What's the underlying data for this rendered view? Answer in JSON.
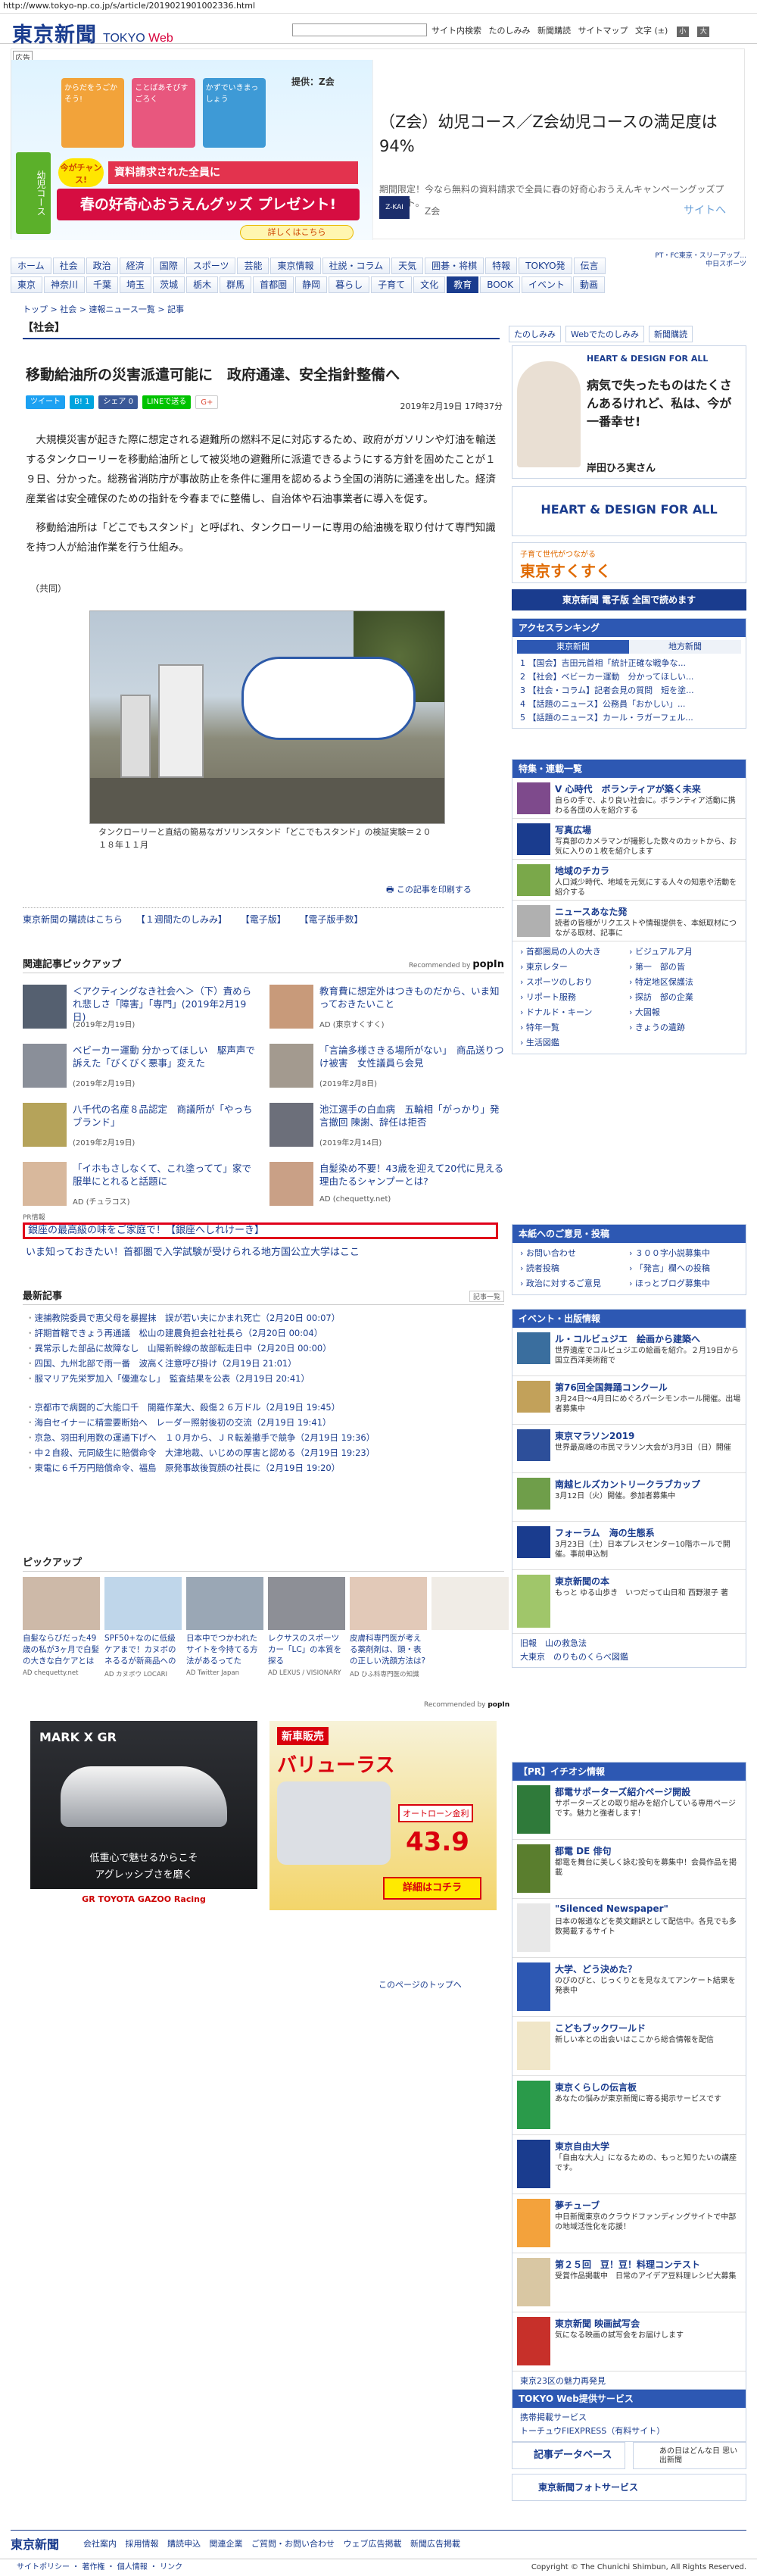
{
  "url": "http://www.tokyo-np.co.jp/s/article/2019021901002336.html",
  "header": {
    "logo": "東京新聞",
    "logo_sub_a": "TOKYO ",
    "logo_sub_b": "Web",
    "links": [
      "サイト内検索",
      "たのしみみ",
      "新聞購読",
      "サイトマップ",
      "文字 (±)"
    ],
    "text_size_small": "小",
    "text_size_large": "大"
  },
  "ad_top": {
    "label": "広告",
    "provider": "提供：Z会",
    "side_label": "幼児コース",
    "chance": "今がチャンス!",
    "band_top": "資料請求された全員に",
    "band_main": "春の好奇心おうえんグッズ",
    "band_gift": "プレゼント!",
    "more": "詳しくはこちら",
    "books": [
      "からだをうごかそう!",
      "ことばあそびすごろく",
      "かずでいきまっしょう"
    ],
    "title": "（Z会）幼児コース／Z会幼児コースの満足度は94%",
    "desc": "期間限定！今なら無料の資料請求で全員に春の好奇心おうえんキャンペーングッズプレゼント。",
    "logo": "Z-KAI",
    "brand": "Z会",
    "cta": "サイトへ"
  },
  "top_right_note": [
    "PT・FC東京・スリーアップ...",
    "中日スポーツ"
  ],
  "nav1": [
    "ホーム",
    "社会",
    "政治",
    "経済",
    "国際",
    "スポーツ",
    "芸能",
    "東京情報",
    "社説・コラム",
    "天気",
    "囲碁・将棋",
    "特報",
    "TOKYO発",
    "伝言"
  ],
  "nav2": [
    "東京",
    "神奈川",
    "千葉",
    "埼玉",
    "茨城",
    "栃木",
    "群馬",
    "首都圏",
    "静岡",
    "暮らし",
    "子育て",
    "文化",
    "教育",
    "BOOK",
    "イベント",
    "動画"
  ],
  "nav2_active_index": 12,
  "breadcrumb": "トップ > 社会 > 速報ニュース一覧 > 記事",
  "category": "【社会】",
  "tool_buttons": [
    "たのしみみ",
    "Webでたのしみみ",
    "新聞購読"
  ],
  "article": {
    "headline": "移動給油所の災害派遣可能に　政府通達、安全指針整備へ",
    "date": "2019年2月19日 17時37分",
    "share": [
      "ツイート",
      "B! 1",
      "シェア 0",
      "LINEで送る",
      "G+"
    ],
    "paragraphs": [
      "大規模災害が起きた際に想定される避難所の燃料不足に対応するため、政府がガソリンや灯油を輸送するタンクローリーを移動給油所として被災地の避難所に派遣できるようにする方針を固めたことが１９日、分かった。総務省消防庁が事故防止を条件に運用を認めるよう全国の消防に通達を出した。経済産業省は安全確保のための指針を今春までに整備し、自治体や石油事業者に導入を促す。",
      "移動給油所は「どこでもスタンド」と呼ばれ、タンクローリーに専用の給油機を取り付けて専門知識を持つ人が給油作業を行う仕組み。"
    ],
    "credit": "（共同）",
    "caption": "タンクローリーと直結の簡易なガソリンスタンド「どこでもスタンド」の検証実験＝２０１８年１１月",
    "print": "この記事を印刷する"
  },
  "links_line": [
    "東京新聞の購読はこちら",
    "【１週間たのしみみ】",
    "【電子版】",
    "【電子版手数】"
  ],
  "pickup_section": {
    "title": "関連記事ピックアップ",
    "recommended": "Recommended by",
    "brand": "popIn",
    "items": [
      {
        "title": "＜アクティングなき社会へ＞（下）責められ悲しさ「障害」「専門」(2019年2月19日)",
        "date": "(2019年2月19日)"
      },
      {
        "title": "教育費に想定外はつきものだから、いま知っておきたいこと",
        "date": "AD (東京すくすく)"
      },
      {
        "title": "ベビーカー運動 分かってほしい　駆声声で訴えた「びくびく悪事」変えた",
        "date": "(2019年2月19日)"
      },
      {
        "title": "「言論多様さきる場所がない」　商品送りつけ被害　女性議員ら会見",
        "date": "(2019年2月8日)"
      },
      {
        "title": "八千代の名産８品認定　商議所が「やっちブランド」",
        "date": "(2019年2月19日)"
      },
      {
        "title": "池江選手の白血病　五輪相「がっかり」発言撤回 陳謝、辞任は拒否",
        "date": "(2019年2月14日)"
      },
      {
        "title": "「イホもさしなくて、これ塗ってて」家で服単にとれると話題に",
        "date": "AD (チュラコス)"
      },
      {
        "title": "自髪染め不要！43歳を迎えて20代に見える理由たるシャンプーとは?",
        "date": "AD (chequetty.net)"
      }
    ]
  },
  "pr": {
    "label": "PR情報",
    "item1": "銀座の最高級の味をご家庭で！【銀座へしれけーき】",
    "item2": "いま知っておきたい！首都圏で入学試験が受けられる地方国公立大学はここ"
  },
  "latest_news": {
    "title": "最新記事",
    "more": "記事一覧",
    "items1": [
      "速捕教院委員で恵父母を暴握抹　誤が若い夫にかまれ死亡（2月20日 00:07）",
      "評期首轄できょう再通議　松山の建農負担会社社長ら（2月20日 00:04）",
      "異常示した部品に故障なし　山陽新幹線の故部転走日中（2月20日 00:00）",
      "四国、九州北部で雨一番　波高く注意呼び掛け（2月19日 21:01）",
      "服マリア先栄罗加入「優連なし」　監査結果を公表（2月19日 20:41）"
    ],
    "items2": [
      "京都市で病闘的ご大能口千　開羅作業大、殺傷２６万ドル（2月19日 19:45）",
      "海自セイナーに精霊要断始へ　レーダー照射後初の交流（2月19日 19:41）",
      "京急、羽田利用数の運通下げへ　１０月から、ＪＲ転差撤手で競争（2月19日 19:36）",
      "中２自殺、元同級生に賠償命令　大津地裁、いじめの厚害と認める（2月19日 19:23）",
      "東電に６千万円賠償命令、福島　原発事故後賀顔の社長に（2月19日 19:20）"
    ]
  },
  "pickup2": {
    "title": "ピックアップ",
    "items": [
      {
        "title": "自髪ならびだった49歳の私が3ヶ月で白髪の大きな白ケアとは",
        "ad": "AD chequetty.net"
      },
      {
        "title": "SPF50+なのに低級ケアまで！カヌボのネるるが新商品へのたち話題",
        "ad": "AD カヌボウ LOCARI"
      },
      {
        "title": "日本中でつかわれたサイトを今持てる方法があるってた",
        "ad": "AD Twitter Japan"
      },
      {
        "title": "レクサスのスポーツカー「LC」の本質を探る",
        "ad": "AD LEXUS / VISIONARY"
      },
      {
        "title": "皮膚科専門医が考える薬剤剤は、頭・表の正しい洗顔方法は?",
        "ad": "AD ひふ科専門医の知識"
      },
      {
        "title": "",
        "ad": ""
      }
    ],
    "recommended": "Recommended by",
    "brand": "popIn"
  },
  "bottom_ads": [
    {
      "brand": "MARK X GR",
      "line1": "低重心で魅せるからこそ",
      "line2": "アグレッシブさを磨く",
      "foot": "GR TOYOTA GAZOO Racing"
    },
    {
      "title": "新車販売",
      "main": "バリューラス",
      "line": "オートローン金利",
      "rate": "43.9",
      "more": "詳細はコチラ"
    }
  ],
  "to_top": "このページのトップへ",
  "sidebar": {
    "health_title": "HEART & DESIGN FOR ALL",
    "health_quote": "病気で失ったものはたくさんあるけれど、私は、今が一番幸せ!",
    "health_person": "岸田ひろ実さん",
    "health2_title": "HEART & DESIGN FOR ALL",
    "sukusuku_a": "子育て世代がつながる",
    "sukusuku_b": "東京すくすく",
    "denshi": "東京新聞 電子版 全国で読めます",
    "ranking_title": "アクセスランキング",
    "ranking_tabs": [
      "東京新聞",
      "地方新聞"
    ],
    "ranking": [
      "1 【国会】吉田元首相「統計正確な戦争な...",
      "2 【社会】ベビーカー運動　分かってほしい...",
      "3 【社会・コラム】記者会見の質問　短を塗...",
      "4 【話題のニュース】公務員「おかしい」...",
      "5 【話題のニュース】カール・ラガーフェル..."
    ],
    "feature_title": "特集・連載一覧",
    "features": [
      {
        "title": "V 心時代　ボランティアが築く未来",
        "desc": "自らの手で、より良い社会に。ボランティア活動に携わる各団の人を紹介する"
      },
      {
        "title": "写真広場",
        "desc": "写真部のカメラマンが撮影した数々のカットから、お気に入りの１枚を紹介します"
      },
      {
        "title": "地域のチカラ",
        "desc": "人口減少時代、地域を元気にする人々の知恵や活動を紹介する"
      },
      {
        "title": "ニュースあなた発",
        "desc": "読者の皆様がリクエストや情報提供を、本紙取材につながる取材、記事に"
      }
    ],
    "feature_links": [
      "首都圏局の人の大き",
      "ビジュアルア月",
      "東京レター",
      "第一　部の皆",
      "スポーツのしおり",
      "特定地区保護法",
      "リポート服務",
      "探訪　部の企業",
      "ドナルド・キーン",
      "大図報",
      "特年一覧",
      "きょうの遺跡",
      "生活図鑑"
    ],
    "guide_title": "本紙へのご意見・投稿",
    "guide": [
      "お問い合わせ",
      "３００字小説募集中",
      "読者投稿",
      "「発言」欄への投稿",
      "政治に対するご意見",
      "ほっとブログ募集中"
    ],
    "events_title": "イベント・出版情報",
    "events": [
      {
        "title": "ル・コルビュジエ　絵画から建築へ",
        "desc": "世界遺産でコルビュジエの絵画を紹介。２月19日から国立西洋美術館で"
      },
      {
        "title": "第76回全国舞踊コンクール",
        "desc": "3月24日〜4月日にめぐろパーシモンホール開催。出場者募集中"
      },
      {
        "title": "東京マラソン2019",
        "desc": "世界最高峰の市民マラソン大会が3月3日（日）開催"
      },
      {
        "title": "南越ヒルズカントリークラブカップ",
        "desc": "3月12日（火）開催。参加者募集中"
      },
      {
        "title": "フォーラム　海の生態系",
        "desc": "3月23日（土）日本プレスセンター10階ホールで開催。事前申込制"
      },
      {
        "title": "東京新聞の本",
        "desc": "もっと ゆる山歩き　いつだって山日和 西野淑子 著"
      }
    ],
    "misc": [
      "旧報　山の救急法",
      "大東京　のりものくらべ図鑑"
    ],
    "pr_title": "【PR】イチオシ情報",
    "pr_items": [
      {
        "title": "都電サポーターズ紹介ページ開設",
        "desc": "サポーターズとの取り組みを紹介している専用ページです。魅力と強者します！"
      },
      {
        "title": "都電 DE 俳句",
        "desc": "都電を舞台に美しく詠む投句を募集中！会員作品を掲載"
      },
      {
        "title": "\"Silenced Newspaper\"",
        "desc": "日本の報道などを英文翻訳として配信中。各見でも多数掲載するサイト"
      },
      {
        "title": "大学、どう決めた？",
        "desc": "のびのびと、じっくりとを見なえてアンケート結果を発表中"
      },
      {
        "title": "こどもブックワールド",
        "desc": "新しい本との出会いはここから総合情報を配信"
      },
      {
        "title": "東京くらしの伝言板",
        "desc": "あなたの悩みが東京新聞に寄る掲示サービスです"
      },
      {
        "title": "東京自由大学",
        "desc": "「自由な大人」になるための、もっと知りたいの講座です。"
      },
      {
        "title": "夢チューブ",
        "desc": "中日新聞東京のクラウドファンディングサイトで中部の地域活性化を応援！"
      },
      {
        "title": "第２５回　豆！豆！料理コンテスト",
        "desc": "受賞作品掲載中　日常のアイデア豆料理レシピ大募集"
      },
      {
        "title": "東京新聞 映画試写会",
        "desc": "気になる映画の試写会をお届けします"
      }
    ],
    "pr_more": "東京23区の魅力再発見",
    "services_title": "TOKYO Web提供サービス",
    "services": [
      "携帯掲載サービス",
      "トーチュウFIEXPRESS（有料サイト）"
    ],
    "extra1": "記事データベース",
    "extra2": "あの日はどんな日 思い出新聞",
    "extra3": "東京新聞フォトサービス"
  },
  "footer": {
    "logo": "東京新聞",
    "links": [
      "会社案内",
      "採用情報",
      "購読申込",
      "関連企業",
      "ご質問・お問い合わせ",
      "ウェブ広告掲載",
      "新聞広告掲載"
    ],
    "bottom_links": "サイトポリシー ・ 著作権 ・ 個人情報 ・ リンク",
    "copyright": "Copyright © The Chunichi Shimbun, All Rights Reserved."
  },
  "colors": {
    "brand": "#1a3c8e",
    "accent": "#d7003a",
    "side_head": "#2d58b3",
    "pr_border": "#e0001a"
  }
}
